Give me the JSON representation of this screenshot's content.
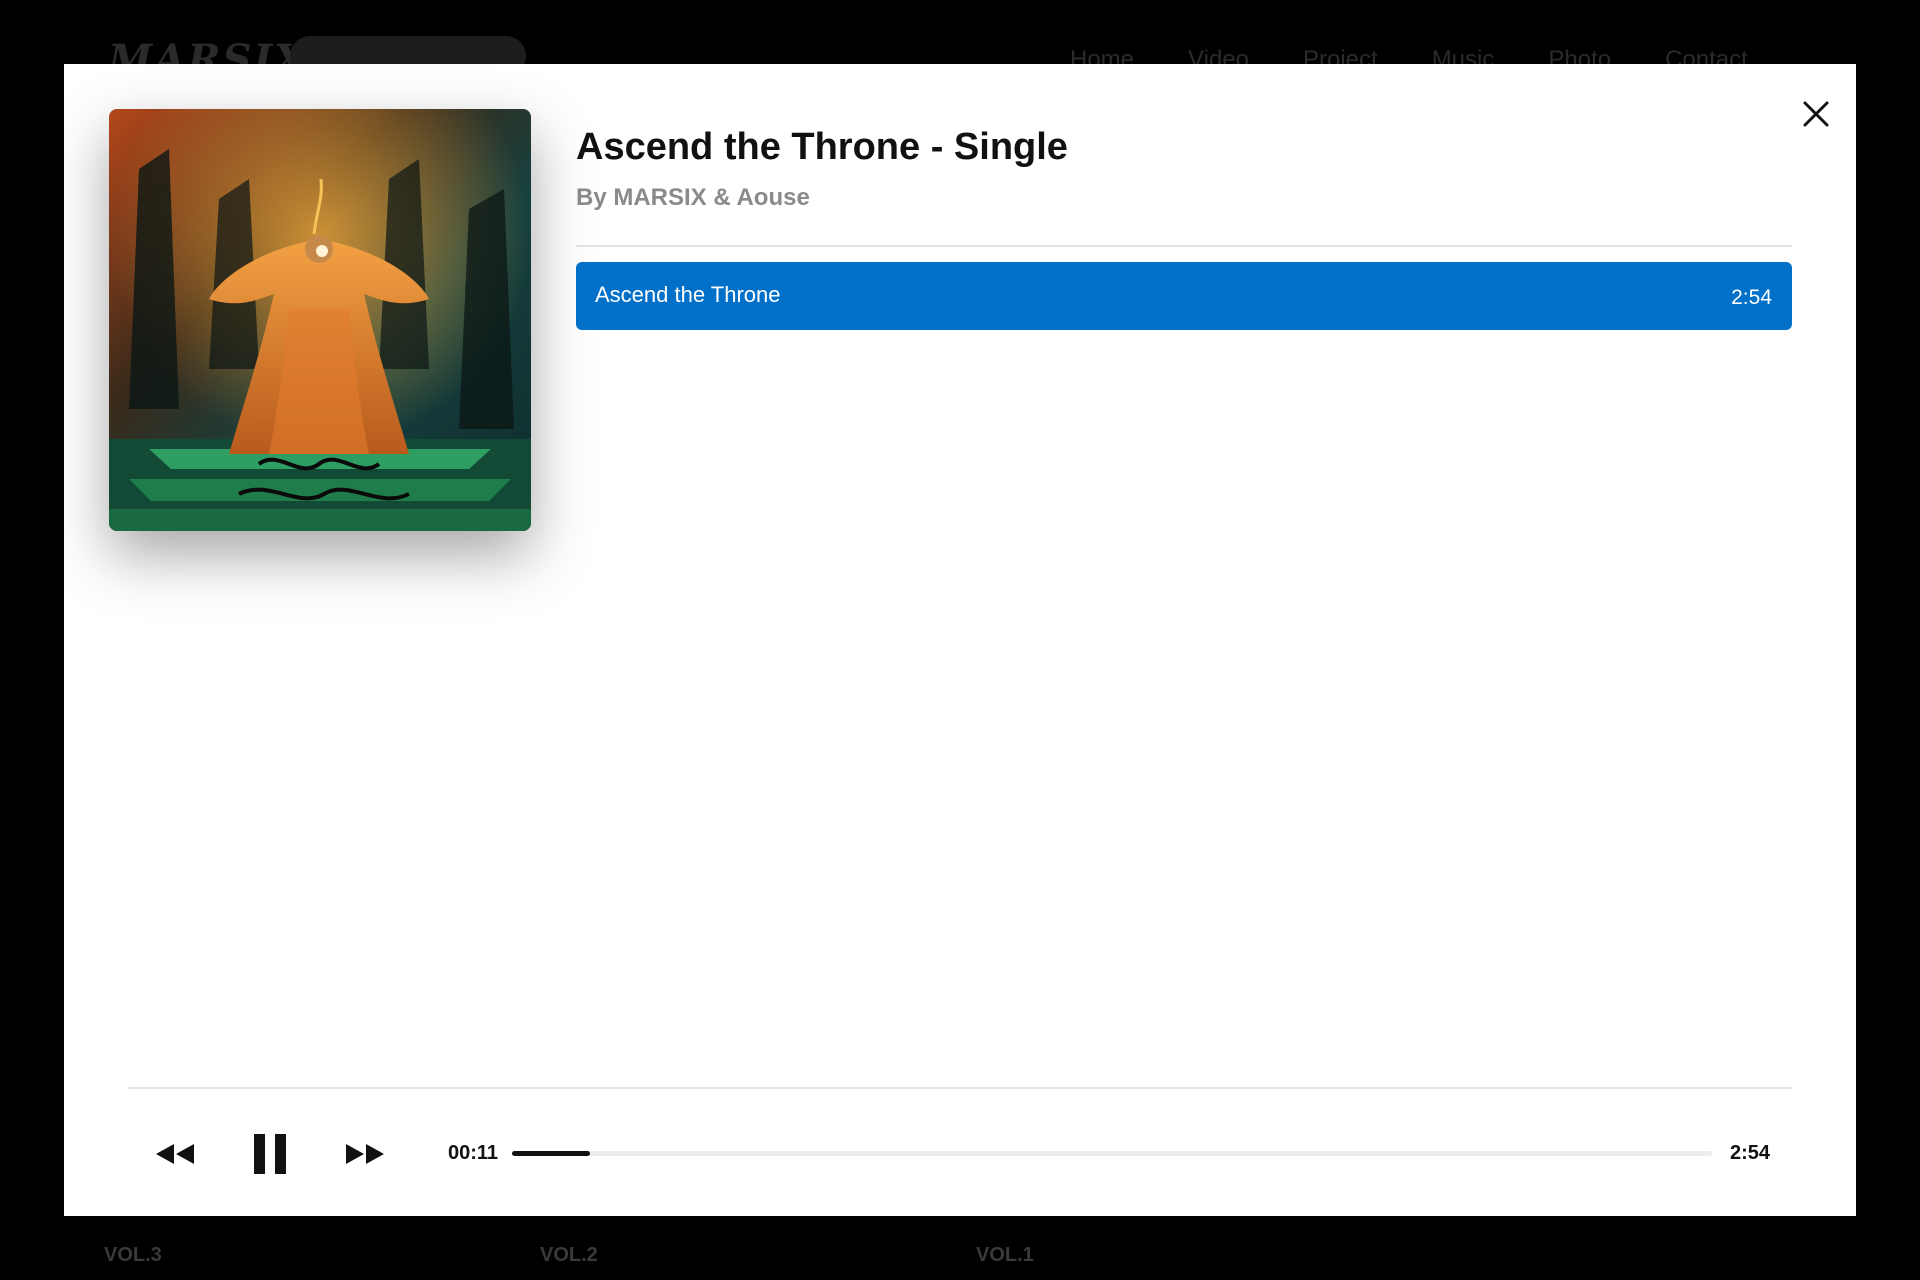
{
  "background": {
    "logo": "MARSIX",
    "nav": [
      "Home",
      "Video",
      "Project",
      "Music",
      "Photo",
      "Contact"
    ],
    "volumes": [
      "VOL.3",
      "VOL.2",
      "VOL.1"
    ]
  },
  "modal": {
    "album_title": "Ascend the Throne - Single",
    "artist_line": "By MARSIX & Aouse",
    "close_icon": "close-icon",
    "tracks": [
      {
        "name": "Ascend the Throne",
        "duration": "2:54",
        "active": true
      }
    ]
  },
  "player": {
    "current_time": "00:11",
    "total_time": "2:54",
    "progress_fraction": 0.065,
    "icons": [
      "rewind-icon",
      "pause-icon",
      "fast-forward-icon"
    ]
  },
  "colors": {
    "accent": "#0070c9",
    "modal_background": "#ffffff",
    "page_background": "#000000"
  }
}
